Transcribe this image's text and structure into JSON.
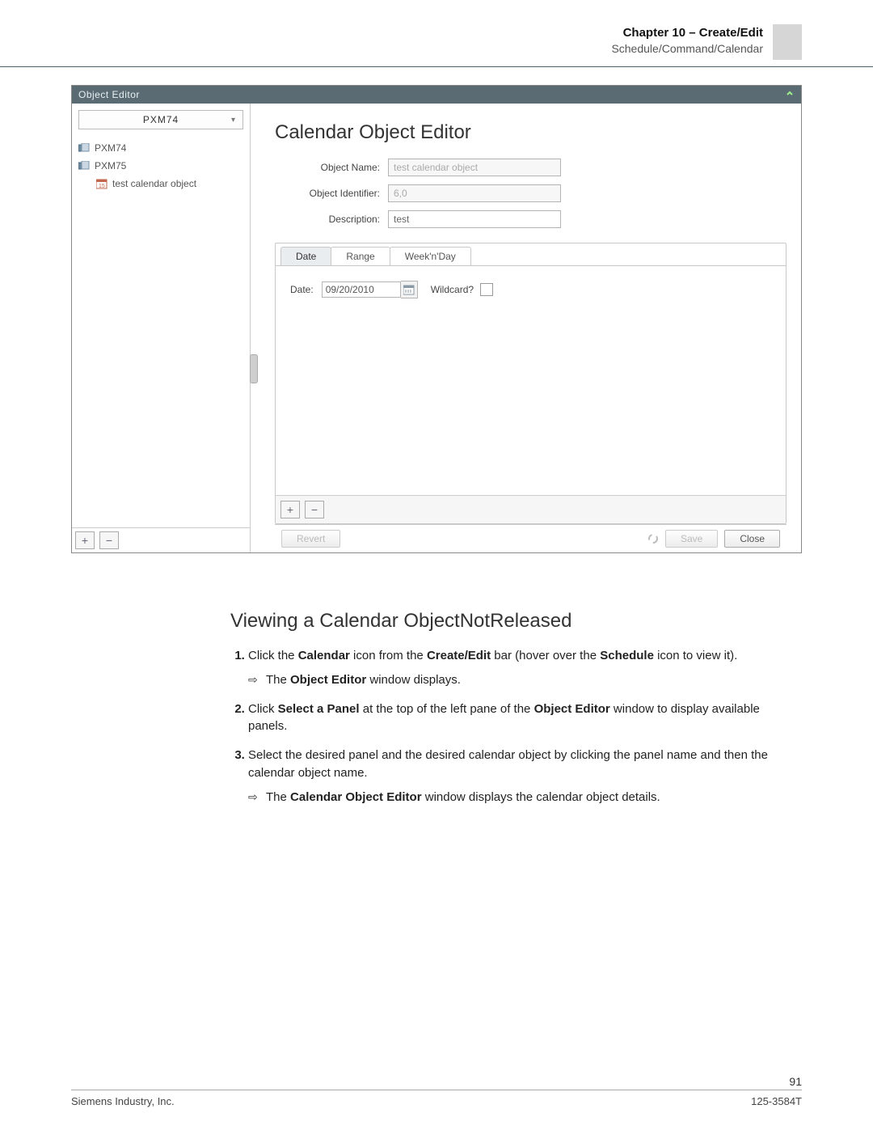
{
  "header": {
    "chapter": "Chapter 10 – Create/Edit",
    "breadcrumb": "Schedule/Command/Calendar"
  },
  "window": {
    "title": "Object Editor"
  },
  "left_panel": {
    "dropdown_value": "PXM74",
    "tree": [
      {
        "label": "PXM74",
        "type": "device",
        "indent": 0
      },
      {
        "label": "PXM75",
        "type": "device",
        "indent": 0
      },
      {
        "label": "test calendar object",
        "type": "calendar",
        "indent": 1
      }
    ],
    "add_label": "+",
    "remove_label": "−"
  },
  "editor": {
    "title": "Calendar Object Editor",
    "fields": {
      "object_name_label": "Object Name:",
      "object_name_value": "test calendar object",
      "identifier_label": "Object Identifier:",
      "identifier_value": "6,0",
      "description_label": "Description:",
      "description_value": "test"
    },
    "tabs": {
      "date": "Date",
      "range": "Range",
      "weeknday": "Week'n'Day"
    },
    "date_tab": {
      "date_label": "Date:",
      "date_value": "09/20/2010",
      "wildcard_label": "Wildcard?",
      "wildcard_checked": false
    },
    "tab_add_label": "+",
    "tab_remove_label": "−",
    "buttons": {
      "revert": "Revert",
      "save": "Save",
      "close": "Close"
    }
  },
  "doc": {
    "heading": "Viewing a Calendar ObjectNotReleased",
    "step1_a": "Click the ",
    "step1_b": "Calendar",
    "step1_c": " icon from the ",
    "step1_d": "Create/Edit",
    "step1_e": " bar (hover over the ",
    "step1_f": "Schedule",
    "step1_g": " icon to view it).",
    "step1_res_a": "The ",
    "step1_res_b": "Object Editor",
    "step1_res_c": " window displays.",
    "step2_a": "Click ",
    "step2_b": "Select a Panel",
    "step2_c": " at the top of the left pane of the ",
    "step2_d": "Object Editor",
    "step2_e": " window to display available panels.",
    "step3": "Select the desired panel and the desired calendar object by clicking the panel name and then the calendar object name.",
    "step3_res_a": "The ",
    "step3_res_b": "Calendar Object Editor",
    "step3_res_c": " window displays the calendar object details."
  },
  "footer": {
    "page_number": "91",
    "company": "Siemens Industry, Inc.",
    "doc_id": "125-3584T"
  }
}
